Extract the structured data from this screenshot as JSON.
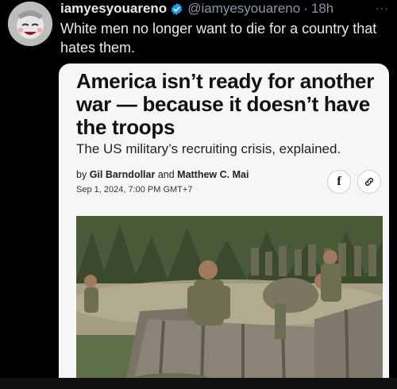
{
  "tweet": {
    "display_name": "iamyesyouareno",
    "handle": "@iamyesyouareno",
    "separator": "·",
    "time": "18h",
    "more_label": "···",
    "text": "White men no longer want to die for a country that hates them."
  },
  "card": {
    "headline": "America isn’t ready for another war — because it doesn’t have the troops",
    "subhead": "The US military’s recruiting crisis, explained.",
    "byline": {
      "prefix": "by ",
      "author1": "Gil Barndollar",
      "and": " and ",
      "author2": "Matthew C. Mai"
    },
    "date": "Sep 1, 2024, 7:00 PM GMT+7",
    "share_facebook_label": "f"
  },
  "colors": {
    "background": "#000000",
    "text_primary": "#e7e9ea",
    "text_secondary": "#8b98a5",
    "verified": "#1d9bf0",
    "card_bg": "#f6f6f6"
  },
  "icons": [
    "verified-badge-icon",
    "more-icon",
    "facebook-icon",
    "link-icon"
  ]
}
